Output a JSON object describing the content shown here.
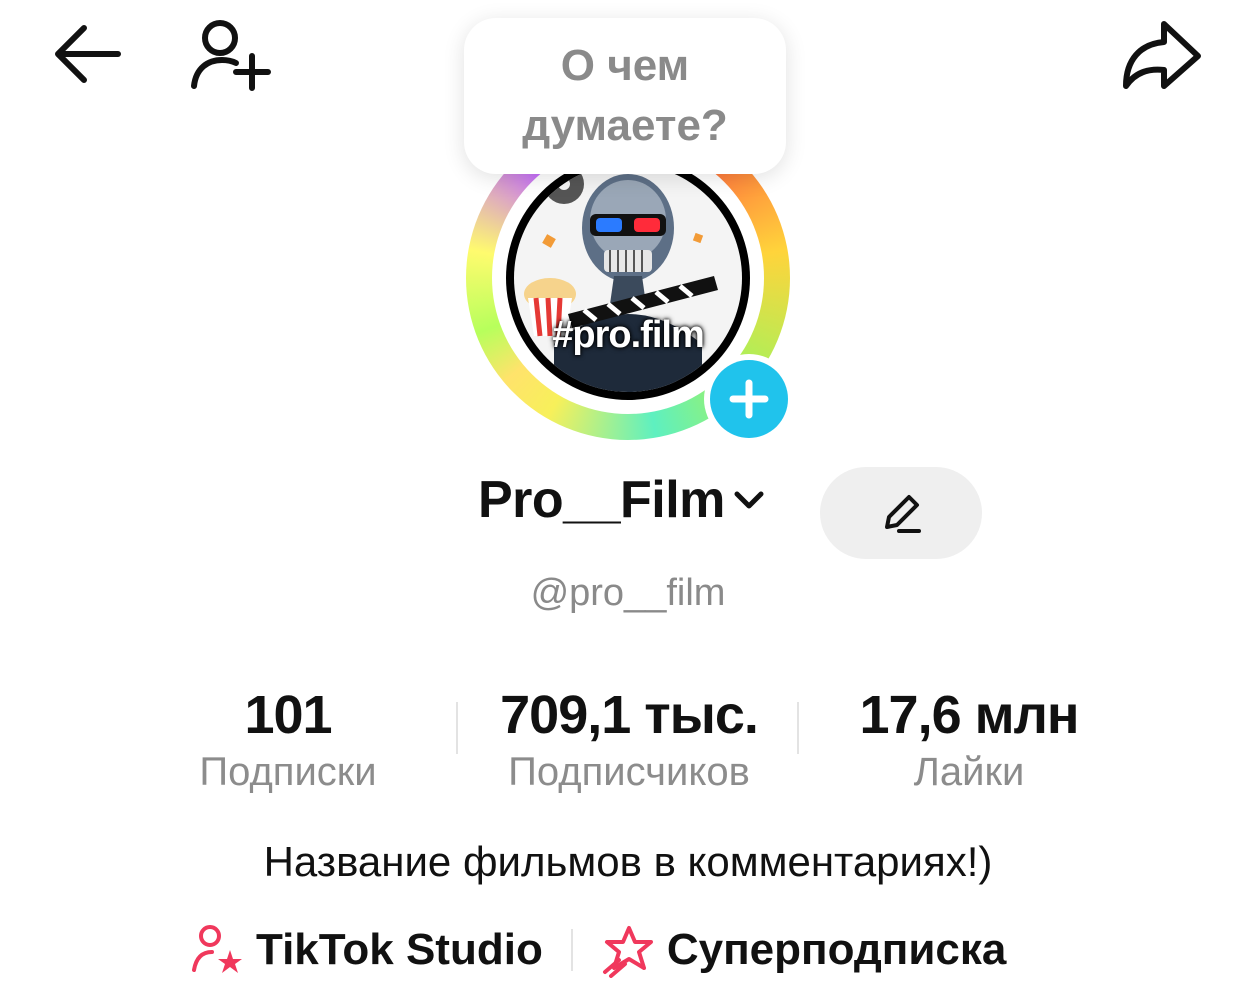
{
  "bubble": {
    "text": "О чем думаете?"
  },
  "avatar": {
    "text": "#pro.film"
  },
  "profile": {
    "name": "Pro__Film",
    "handle": "@pro__film",
    "bio": "Название фильмов в комментариях!)"
  },
  "stats": {
    "following": {
      "value": "101",
      "label": "Подписки"
    },
    "followers": {
      "value": "709,1 тыс.",
      "label": "Подписчиков"
    },
    "likes": {
      "value": "17,6 млн",
      "label": "Лайки"
    }
  },
  "links": {
    "studio": "TikTok Studio",
    "super": "Суперподписка"
  },
  "icons": {
    "back": "arrow-left-icon",
    "add_friend": "person-plus-icon",
    "share": "share-arrow-icon",
    "edit": "pencil-icon",
    "chevron": "chevron-down-icon",
    "plus": "plus-icon",
    "studio": "person-star-icon",
    "super": "star-badge-icon"
  },
  "colors": {
    "accent_blue": "#20c3ec",
    "pink": "#f0385c",
    "muted_text": "#8a8a8a"
  }
}
